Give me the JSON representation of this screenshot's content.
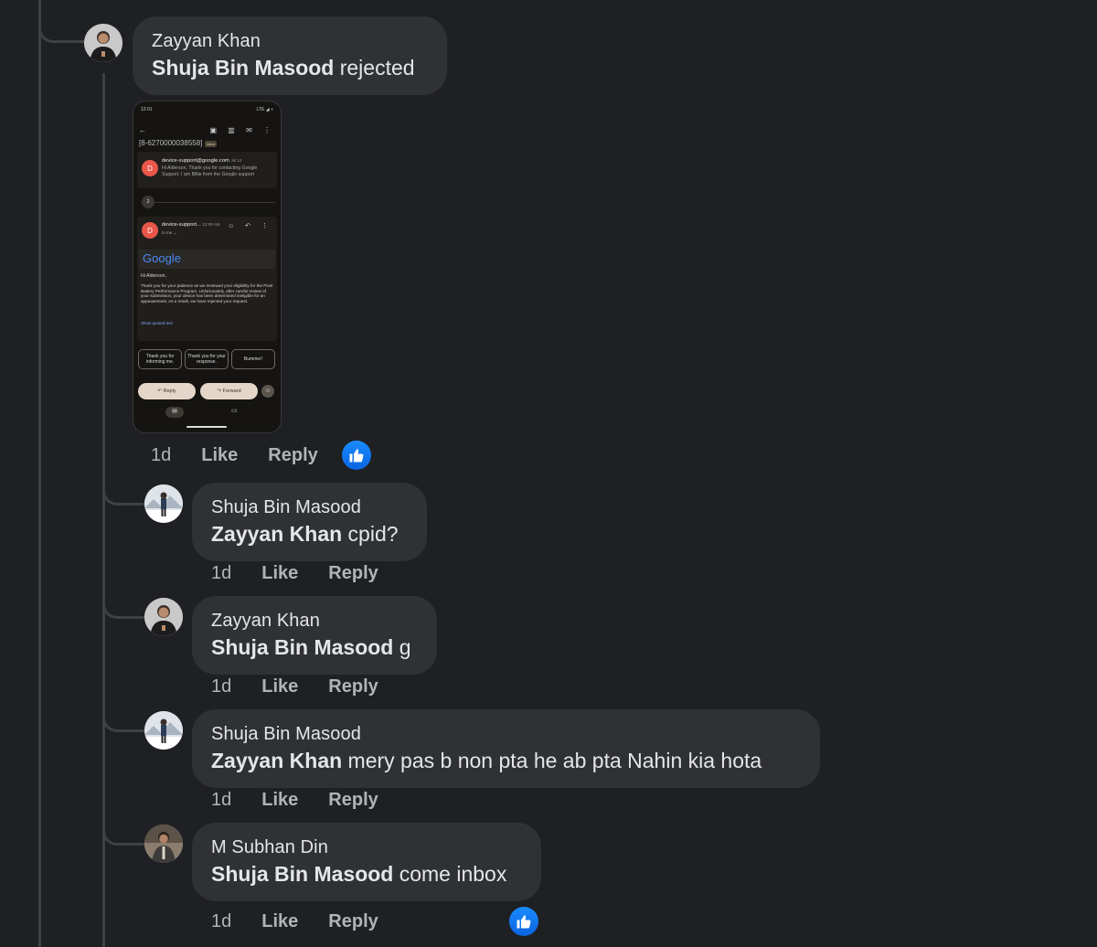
{
  "thread": {
    "parent_comment": {
      "author": "Zayyan Khan",
      "mention": "Shuja Bin Masood",
      "text": " rejected",
      "time": "1d",
      "like_label": "Like",
      "reply_label": "Reply",
      "attachment": {
        "status_time": "12:01",
        "status_signal": "LTE ◢ ◖",
        "snippet_header": "[8-6270000038558]",
        "tag": "Inbox",
        "first_sender": "device-support@google.com",
        "first_date": "Jul 12",
        "first_preview": "Hi Alderson, Thank you for contacting Google Support. I am Billie from the Google support",
        "collapsed_count": "2",
        "second_sender": "device-support...",
        "second_time": "12:00 AM",
        "to_me": "to me ⌄",
        "logo_text": "Google",
        "greeting": "Hi Alderson,",
        "body": "Thank you for your patience as we reviewed your eligibility for the Pixel Battery Performance Program. Unfortunately, after careful review of your submission, your device has been determined ineligible for an appeasement. As a result, we have rejected your request.",
        "quoted": "Show quoted text",
        "chips": [
          "Thank you for informing me.",
          "Thank you for your response.",
          "Bummer!"
        ],
        "reply_btn": "Reply",
        "forward_btn": "Forward"
      }
    },
    "replies": [
      {
        "author": "Shuja Bin Masood",
        "mention": "Zayyan Khan",
        "text": " cpid?",
        "time": "1d",
        "like_label": "Like",
        "reply_label": "Reply"
      },
      {
        "author": "Zayyan Khan",
        "mention": "Shuja Bin Masood",
        "text": " g",
        "time": "1d",
        "like_label": "Like",
        "reply_label": "Reply"
      },
      {
        "author": "Shuja Bin Masood",
        "mention": "Zayyan Khan",
        "text": " mery pas b non pta he ab pta Nahin kia hota",
        "time": "1d",
        "like_label": "Like",
        "reply_label": "Reply"
      },
      {
        "author": "M Subhan Din",
        "mention": "Shuja Bin Masood",
        "text": " come inbox",
        "time": "1d",
        "like_label": "Like",
        "reply_label": "Reply"
      }
    ]
  },
  "colors": {
    "background": "#1f2023",
    "bubble": "#303134",
    "text": "#e4e6eb",
    "secondary": "#b0b3b8",
    "like_blue": "#1877f2"
  },
  "icons": [
    "thumbs-up-icon",
    "avatar-icon"
  ]
}
